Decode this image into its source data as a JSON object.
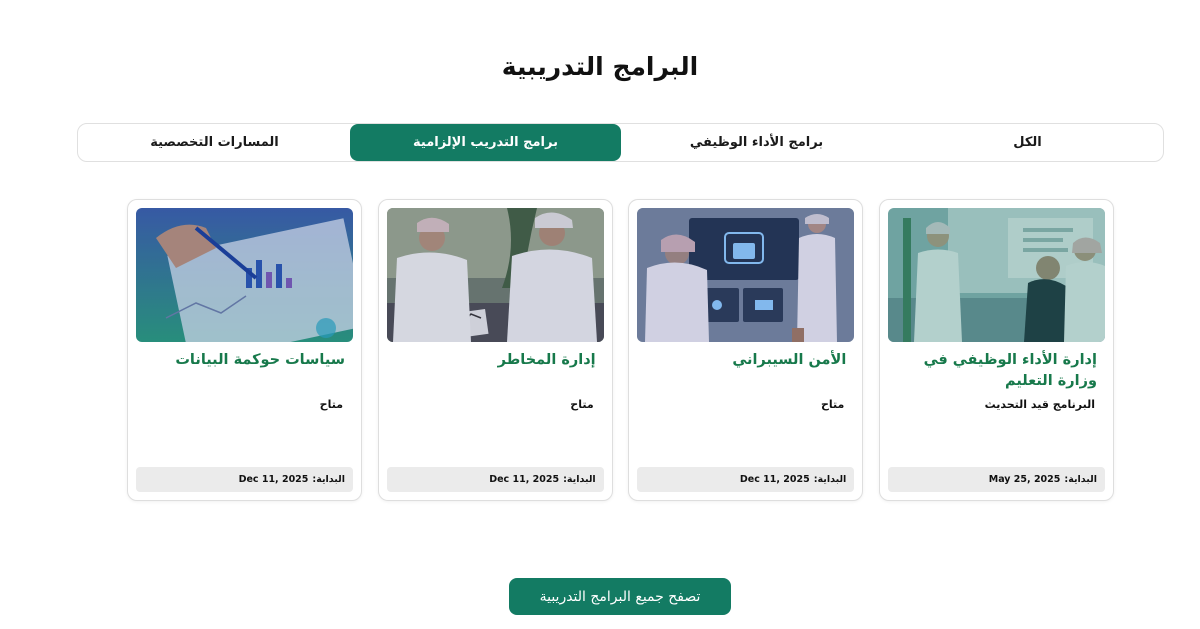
{
  "page": {
    "title": "البرامج التدريبية"
  },
  "tabs": [
    {
      "label": "الكل",
      "active": false
    },
    {
      "label": "برامج الأداء الوظيفي",
      "active": false
    },
    {
      "label": "برامج التدريب الإلزامية",
      "active": true
    },
    {
      "label": "المسارات التخصصية",
      "active": false
    }
  ],
  "cards": [
    {
      "title": "إدارة الأداء الوظيفي في وزارة التعليم",
      "status": "البرنامج قيد التحديث",
      "date_label": "البداية:",
      "date": "May 25, 2025",
      "image": "presentation-photo"
    },
    {
      "title": "الأمن السيبراني",
      "status": "متاح",
      "date_label": "البداية:",
      "date": "Dec 11, 2025",
      "image": "cybersecurity-photo"
    },
    {
      "title": "إدارة المخاطر",
      "status": "متاح",
      "date_label": "البداية:",
      "date": "Dec 11, 2025",
      "image": "meeting-photo"
    },
    {
      "title": "سياسات حوكمة البيانات",
      "status": "متاح",
      "date_label": "البداية:",
      "date": "Dec 11, 2025",
      "image": "data-charts-photo"
    }
  ],
  "browse_button": {
    "label": "تصفح جميع البرامج التدريبية"
  },
  "colors": {
    "accent": "#137b63",
    "title_green": "#17794b",
    "date_bg": "#ebebeb"
  }
}
